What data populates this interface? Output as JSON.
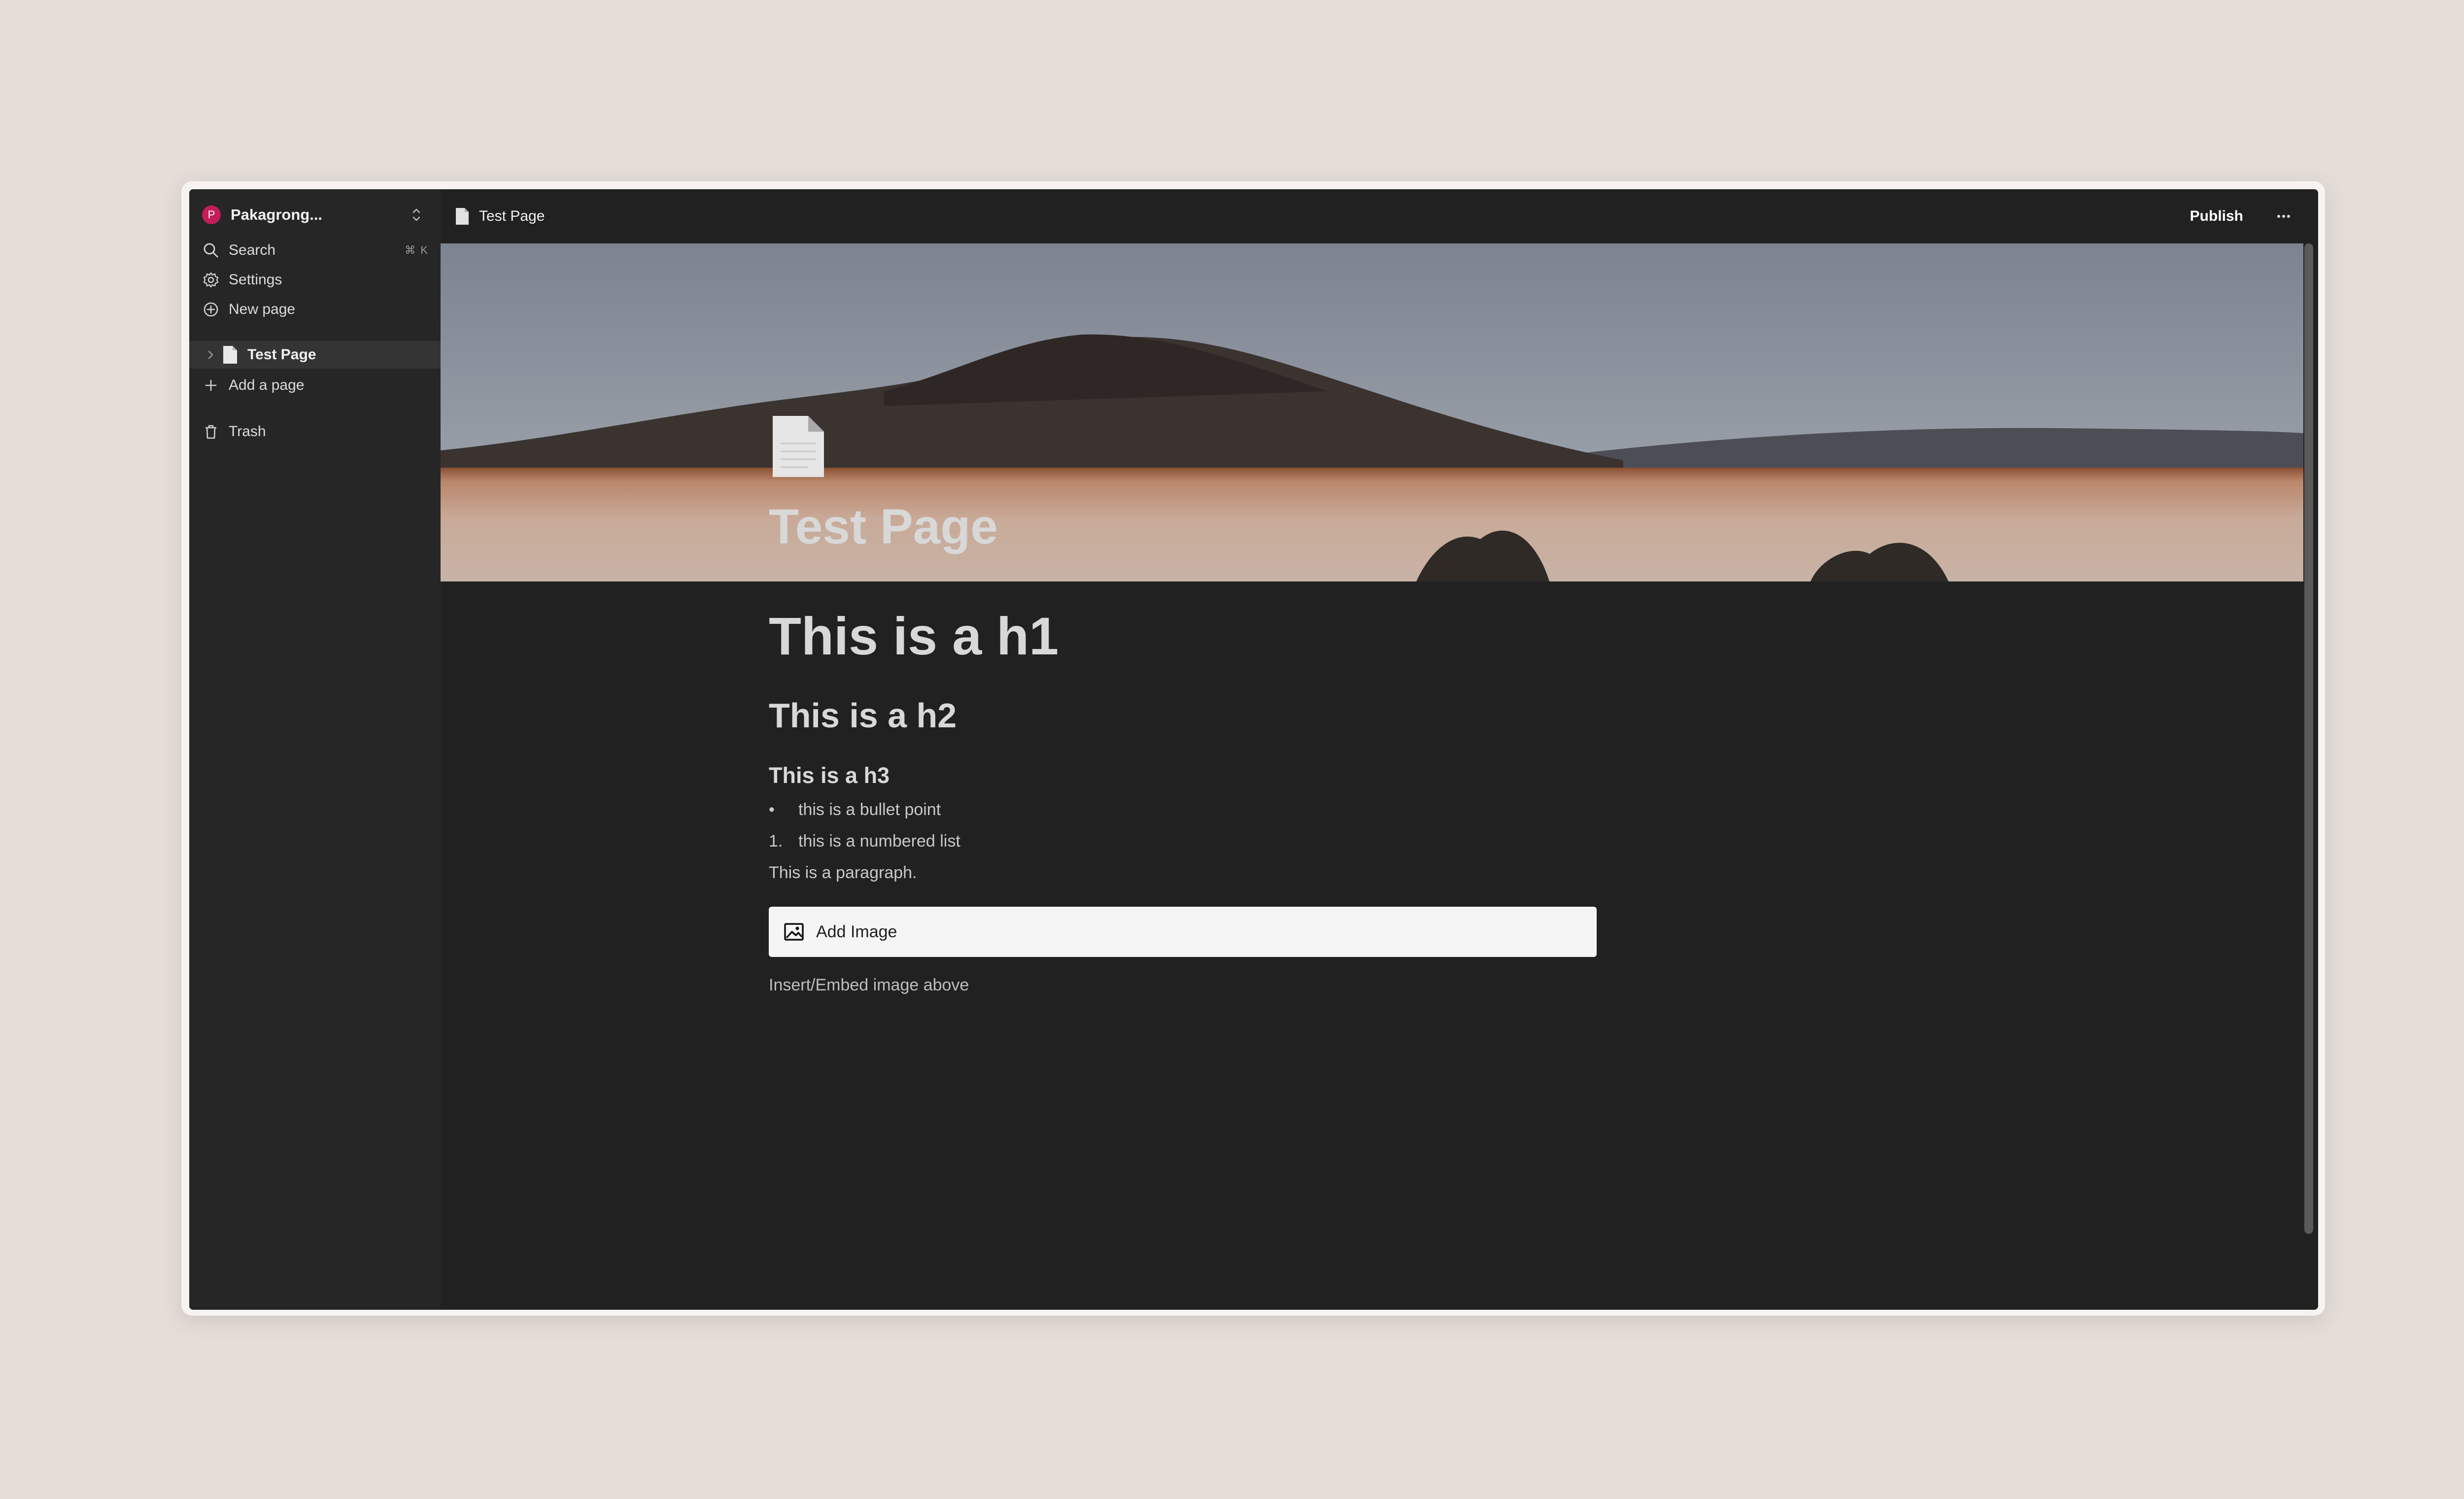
{
  "workspace": {
    "name": "Pakagrong...",
    "avatar_letter": "P",
    "avatar_color": "#c31d5a"
  },
  "sidebar": {
    "search_label": "Search",
    "search_shortcut": "⌘ K",
    "settings_label": "Settings",
    "new_page_label": "New page",
    "pages": [
      {
        "label": "Test Page"
      }
    ],
    "add_page_label": "Add a page",
    "trash_label": "Trash"
  },
  "topbar": {
    "breadcrumb": "Test Page",
    "publish_label": "Publish"
  },
  "page": {
    "title": "Test Page",
    "h1": "This is a h1",
    "h2": "This is a h2",
    "h3": "This is a h3",
    "bullet_marker": "•",
    "bullet": "this is a bullet point",
    "numbered_marker": "1.",
    "numbered": "this is a numbered list",
    "paragraph": "This is a paragraph.",
    "add_image_label": "Add Image",
    "image_caption": "Insert/Embed image above"
  },
  "colors": {
    "background": "#e4ddd8",
    "app_bg": "#212121",
    "sidebar_bg": "#262626",
    "selected_bg": "#343434"
  }
}
